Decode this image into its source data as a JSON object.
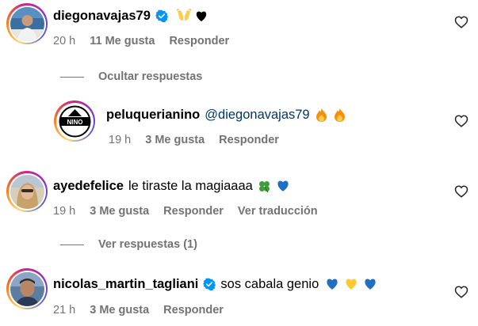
{
  "comments": [
    {
      "username": "diegonavajas79",
      "verified": true,
      "text": "",
      "emoji": [
        "raised-hands",
        "black-heart"
      ],
      "time": "20 h",
      "likes": "11 Me gusta",
      "reply": "Responder"
    },
    {
      "username": "peluquerianino",
      "verified": false,
      "mention": "@diegonavajas79",
      "emoji": [
        "fire",
        "fire"
      ],
      "time": "19 h",
      "likes": "3 Me gusta",
      "reply": "Responder",
      "avatar_text": "NINO"
    },
    {
      "username": "ayedefelice",
      "verified": false,
      "text": "le tiraste la magiaaaa",
      "emoji": [
        "four-leaf-clover",
        "blue-heart"
      ],
      "time": "19 h",
      "likes": "3 Me gusta",
      "reply": "Responder",
      "translate": "Ver traducción"
    },
    {
      "username": "nicolas_martin_tagliani",
      "verified": true,
      "text": "sos cabala genio",
      "emoji": [
        "blue-heart",
        "yellow-heart",
        "blue-heart"
      ],
      "time": "21 h",
      "likes": "3 Me gusta",
      "reply": "Responder"
    }
  ],
  "toggles": {
    "hide_replies": "Ocultar respuestas",
    "view_replies": "Ver respuestas (1)"
  },
  "colors": {
    "meta": "#737373",
    "verified": "#0095f6",
    "mention": "#00376b"
  }
}
